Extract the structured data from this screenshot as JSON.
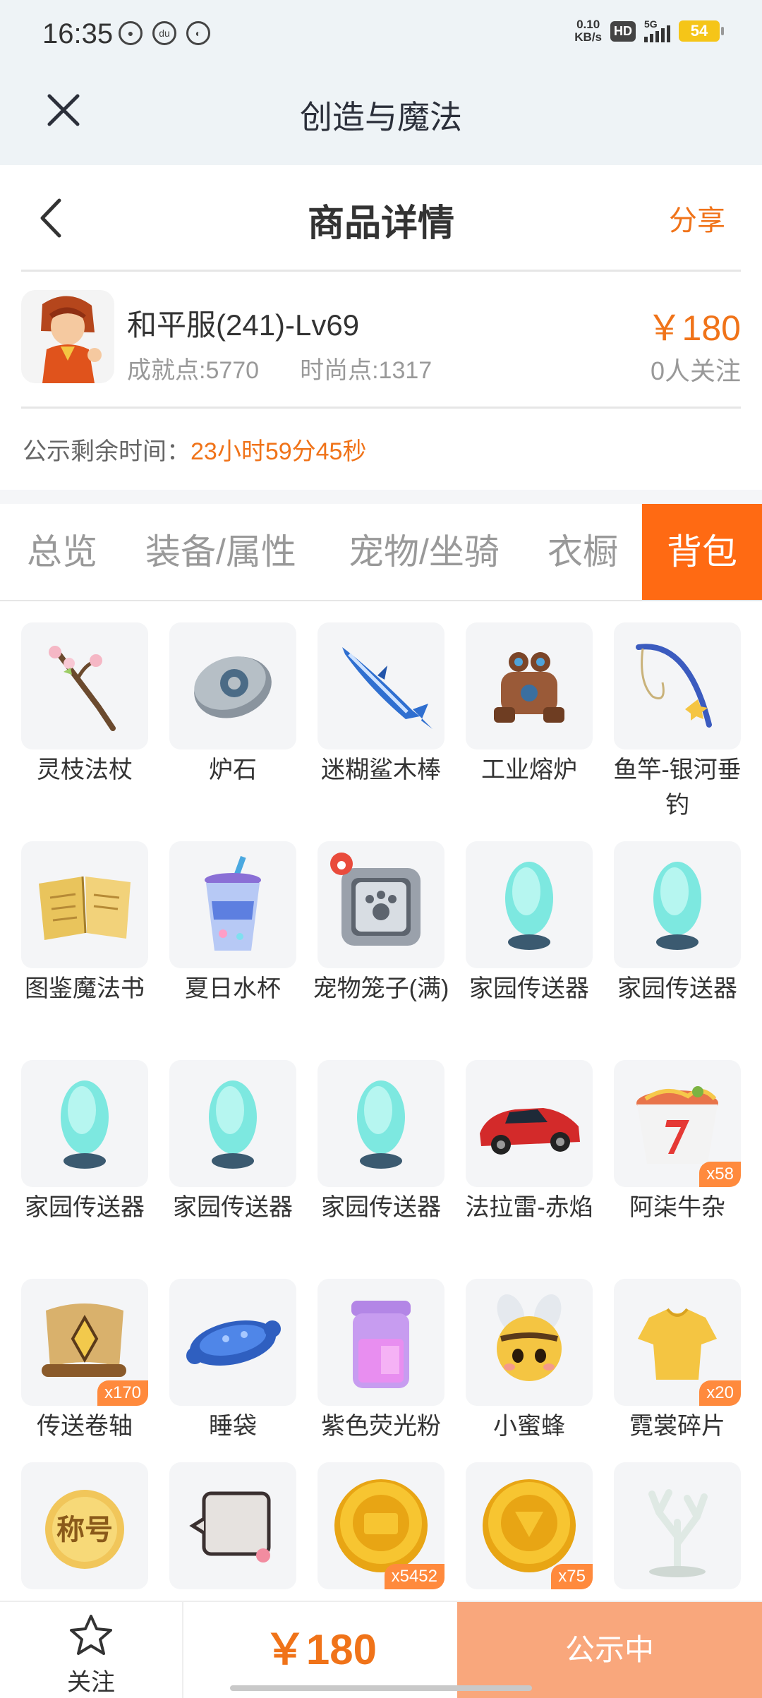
{
  "status_bar": {
    "time": "16:35",
    "net_speed_value": "0.10",
    "net_speed_unit": "KB/s",
    "hd": "HD",
    "network": "5G",
    "battery": "54"
  },
  "app_header": {
    "title": "创造与魔法"
  },
  "page_header": {
    "title": "商品详情",
    "share_label": "分享"
  },
  "product": {
    "name": "和平服(241)-Lv69",
    "achievement": "成就点:5770",
    "fashion": "时尚点:1317",
    "price": "￥180",
    "followers": "0人关注"
  },
  "notice": {
    "label": "公示剩余时间：",
    "value": "23小时59分45秒"
  },
  "tabs": [
    "总览",
    "装备/属性",
    "宠物/坐骑",
    "衣橱",
    "背包"
  ],
  "active_tab": "背包",
  "items": [
    {
      "name": "灵枝法杖",
      "icon": "branch-staff-icon"
    },
    {
      "name": "炉石",
      "icon": "hearthstone-icon"
    },
    {
      "name": "迷糊鲨木棒",
      "icon": "shark-club-icon"
    },
    {
      "name": "工业熔炉",
      "icon": "industrial-furnace-icon"
    },
    {
      "name": "鱼竿-银河垂钓",
      "icon": "fishing-rod-icon"
    },
    {
      "name": "图鉴魔法书",
      "icon": "magic-book-icon"
    },
    {
      "name": "夏日水杯",
      "icon": "summer-cup-icon"
    },
    {
      "name": "宠物笼子(满)",
      "icon": "pet-cage-icon"
    },
    {
      "name": "家园传送器",
      "icon": "home-teleporter-icon"
    },
    {
      "name": "家园传送器",
      "icon": "home-teleporter-icon"
    },
    {
      "name": "家园传送器",
      "icon": "home-teleporter-icon"
    },
    {
      "name": "家园传送器",
      "icon": "home-teleporter-icon"
    },
    {
      "name": "家园传送器",
      "icon": "home-teleporter-icon"
    },
    {
      "name": "法拉雷-赤焰",
      "icon": "red-sports-car-icon"
    },
    {
      "name": "阿柒牛杂",
      "icon": "noodle-bowl-icon",
      "count": "x58"
    },
    {
      "name": "传送卷轴",
      "icon": "teleport-scroll-icon",
      "count": "x170"
    },
    {
      "name": "睡袋",
      "icon": "sleeping-bag-icon"
    },
    {
      "name": "紫色荧光粉",
      "icon": "purple-powder-jar-icon"
    },
    {
      "name": "小蜜蜂",
      "icon": "bee-icon"
    },
    {
      "name": "霓裳碎片",
      "icon": "clothing-fragment-icon",
      "count": "x20"
    },
    {
      "name": "",
      "icon": "title-card-icon",
      "icon_text": "称号"
    },
    {
      "name": "",
      "icon": "chat-bubble-icon"
    },
    {
      "name": "",
      "icon": "gold-coin-icon",
      "count": "x5452"
    },
    {
      "name": "",
      "icon": "gold-coin-icon",
      "count": "x75"
    },
    {
      "name": "",
      "icon": "coral-icon"
    }
  ],
  "bottom_bar": {
    "follow_label": "关注",
    "price": "￥180",
    "status": "公示中"
  },
  "colors": {
    "accent": "#f07319",
    "active_tab_bg": "#ff6a13",
    "status_bg": "#f9a77c"
  }
}
